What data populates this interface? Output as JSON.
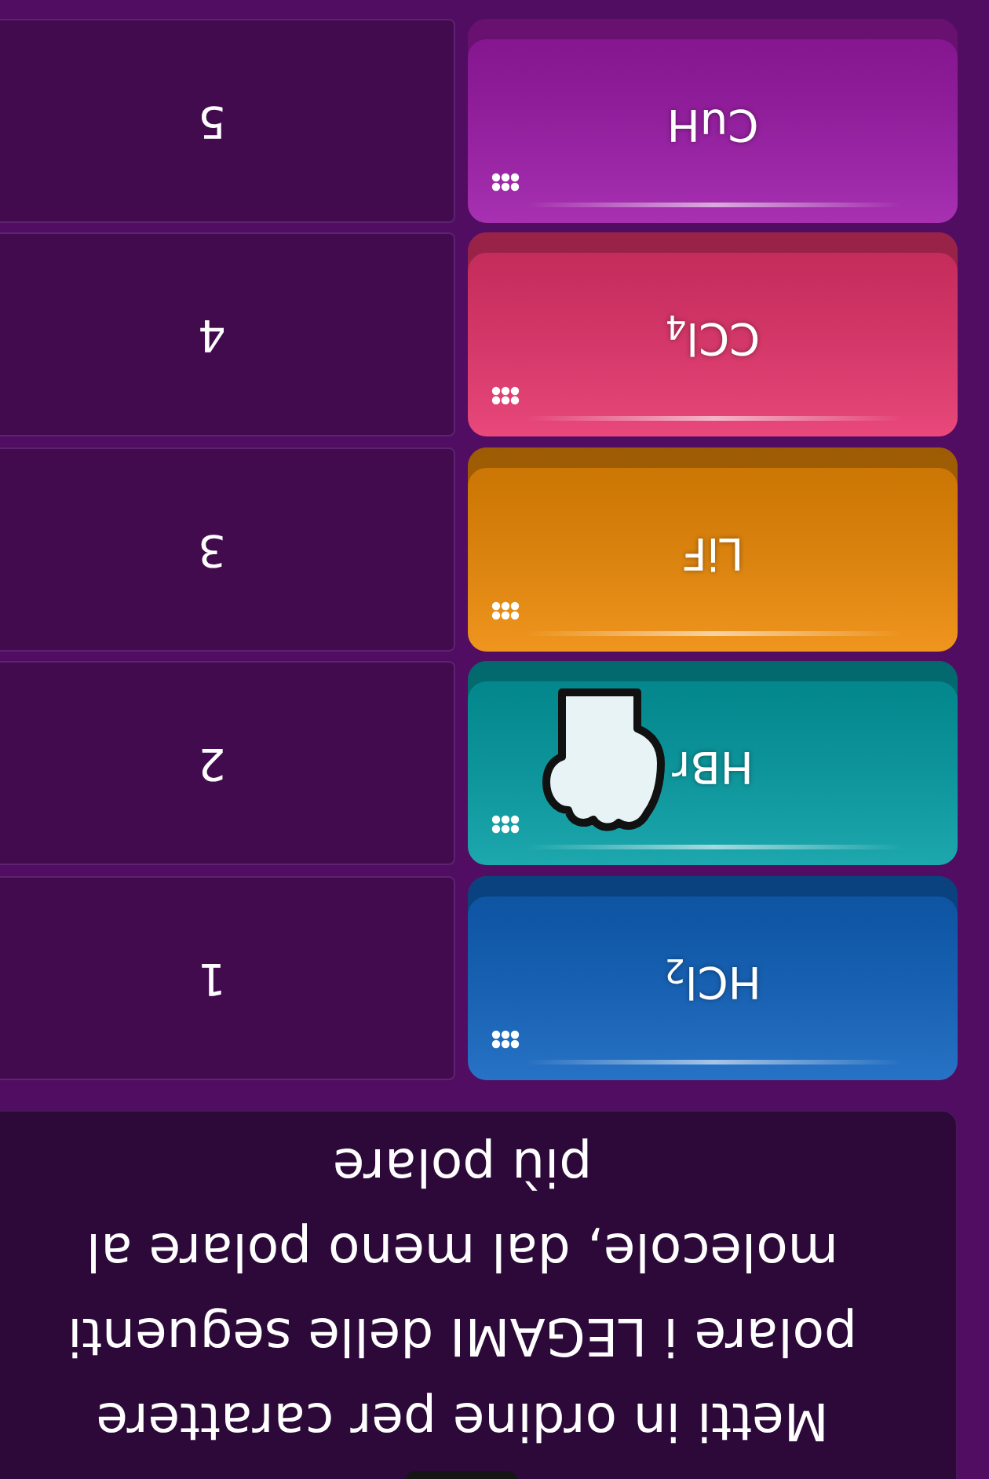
{
  "question": {
    "text": "Metti in ordine per carattere polare i LEGAMI delle seguenti molecole, dal meno polare al più polare"
  },
  "tiles": [
    {
      "formula": "HCl$_{2}$",
      "color": "#1063bf",
      "grabbed": false
    },
    {
      "formula": "HBr",
      "color": "#049ea5",
      "grabbed": true
    },
    {
      "formula": "LiF",
      "color": "#ee8a06",
      "grabbed": false
    },
    {
      "formula": "CCl$_{4}$",
      "color": "#e6346c",
      "grabbed": false
    },
    {
      "formula": "CuH",
      "color": "#9d1aa9",
      "grabbed": false
    }
  ],
  "slots": [
    {
      "label": "1"
    },
    {
      "label": "2"
    },
    {
      "label": "3"
    },
    {
      "label": "4"
    },
    {
      "label": "5"
    }
  ]
}
